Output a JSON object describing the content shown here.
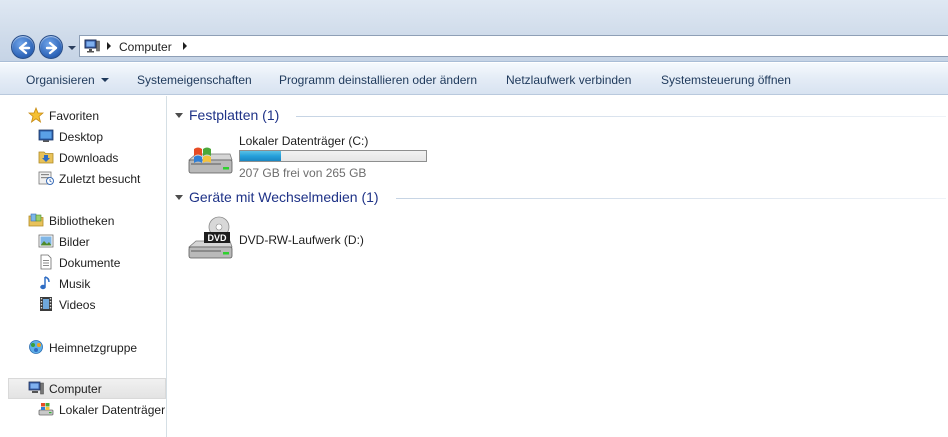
{
  "address": {
    "crumbs": [
      "Computer"
    ]
  },
  "toolbar": {
    "organize_label": "Organisieren",
    "system_properties_label": "Systemeigenschaften",
    "uninstall_label": "Programm deinstallieren oder ändern",
    "map_drive_label": "Netzlaufwerk verbinden",
    "control_panel_label": "Systemsteuerung öffnen"
  },
  "sidebar": {
    "favorites": {
      "label": "Favoriten",
      "items": [
        {
          "label": "Desktop",
          "icon": "desktop-icon"
        },
        {
          "label": "Downloads",
          "icon": "downloads-folder-icon"
        },
        {
          "label": "Zuletzt besucht",
          "icon": "recent-places-icon"
        }
      ]
    },
    "libraries": {
      "label": "Bibliotheken",
      "items": [
        {
          "label": "Bilder",
          "icon": "pictures-icon"
        },
        {
          "label": "Dokumente",
          "icon": "documents-icon"
        },
        {
          "label": "Musik",
          "icon": "music-icon"
        },
        {
          "label": "Videos",
          "icon": "videos-icon"
        }
      ]
    },
    "homegroup": {
      "label": "Heimnetzgruppe"
    },
    "computer": {
      "label": "Computer",
      "selected": true,
      "items": [
        {
          "label": "Lokaler Datenträger",
          "icon": "local-disk-icon"
        }
      ]
    }
  },
  "main": {
    "groups": [
      {
        "header": "Festplatten (1)",
        "items": [
          {
            "name": "Lokaler Datenträger (C:)",
            "free_text": "207 GB frei von 265 GB",
            "used_fraction": 0.22
          }
        ]
      },
      {
        "header": "Geräte mit Wechselmedien (1)",
        "items": [
          {
            "name": "DVD-RW-Laufwerk (D:)",
            "icon_label": "DVD"
          }
        ]
      }
    ]
  },
  "colors": {
    "group_header": "#1e3287",
    "usage_bar": "#26a0da",
    "command_text": "#1e395b"
  }
}
